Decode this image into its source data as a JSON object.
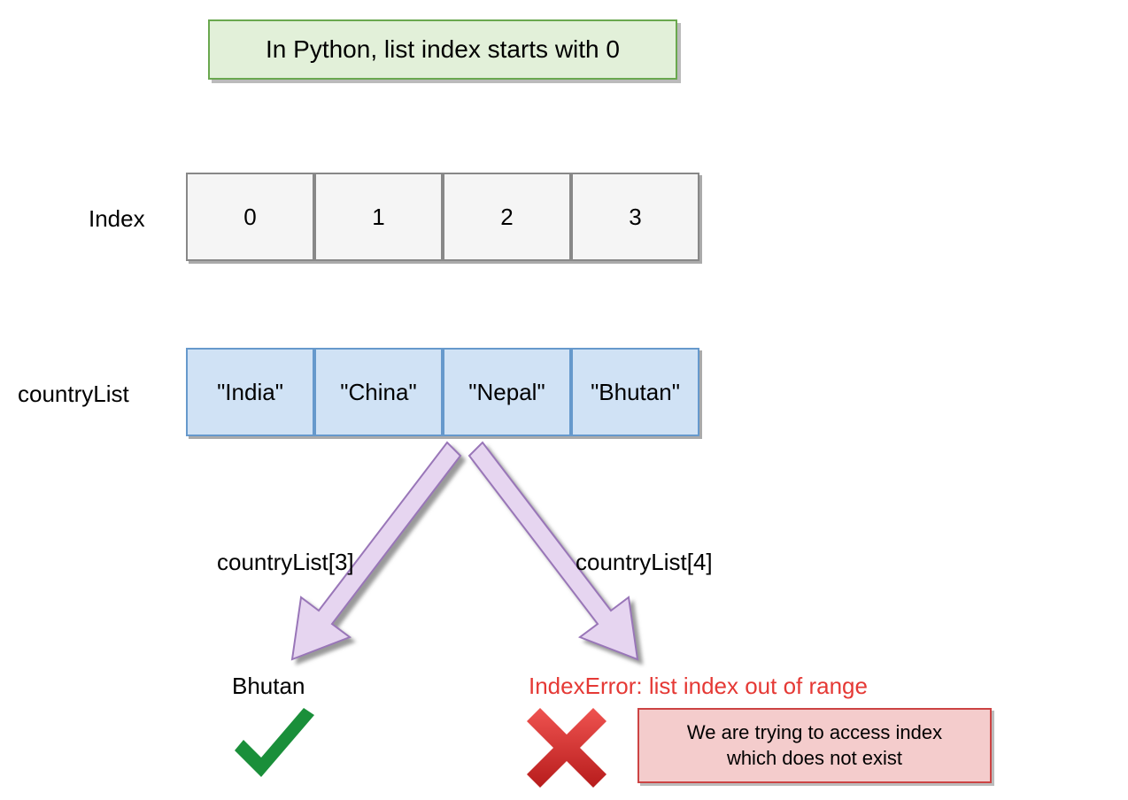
{
  "title": "In Python, list index starts with 0",
  "indexLabel": "Index",
  "listLabel": "countryList",
  "indices": [
    "0",
    "1",
    "2",
    "3"
  ],
  "values": [
    "\"India\"",
    "\"China\"",
    "\"Nepal\"",
    "\"Bhutan\""
  ],
  "leftAccess": "countryList[3]",
  "rightAccess": "countryList[4]",
  "leftResult": "Bhutan",
  "errorText": "IndexError: list index out of range",
  "noteLine1": "We are trying to access index",
  "noteLine2": "which does not exist"
}
